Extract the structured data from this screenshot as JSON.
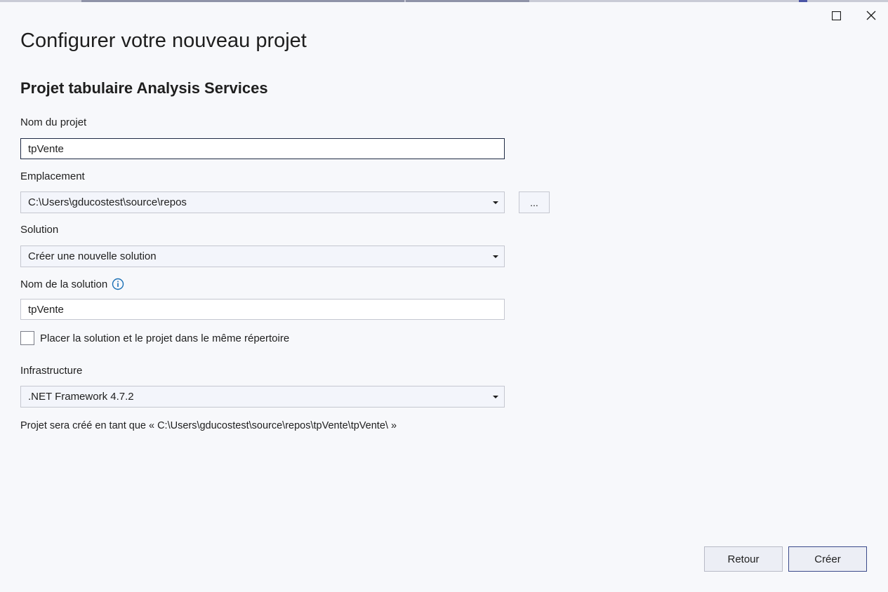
{
  "window": {
    "title": "Configurer votre nouveau projet",
    "subtitle": "Projet tabulaire Analysis Services"
  },
  "project_name": {
    "label": "Nom du projet",
    "value": "tpVente"
  },
  "location": {
    "label": "Emplacement",
    "value": "C:\\Users\\gducostest\\source\\repos",
    "browse_label": "..."
  },
  "solution": {
    "label": "Solution",
    "value": "Créer une nouvelle solution"
  },
  "solution_name": {
    "label": "Nom de la solution",
    "value": "tpVente"
  },
  "same_directory": {
    "label": "Placer la solution et le projet dans le même répertoire",
    "checked": false
  },
  "framework": {
    "label": "Infrastructure",
    "value": ".NET Framework 4.7.2"
  },
  "path_note": "Projet sera créé en tant que « C:\\Users\\gducostest\\source\\repos\\tpVente\\tpVente\\ »",
  "buttons": {
    "back": "Retour",
    "create": "Créer"
  },
  "colors": {
    "background": "#f7f8fb",
    "info_icon": "#1a6fb5",
    "create_border": "#3b4a8a"
  },
  "icons": {
    "maximize": "maximize-icon",
    "close": "close-icon",
    "info": "info-icon",
    "dropdown": "chevron-down-icon"
  }
}
